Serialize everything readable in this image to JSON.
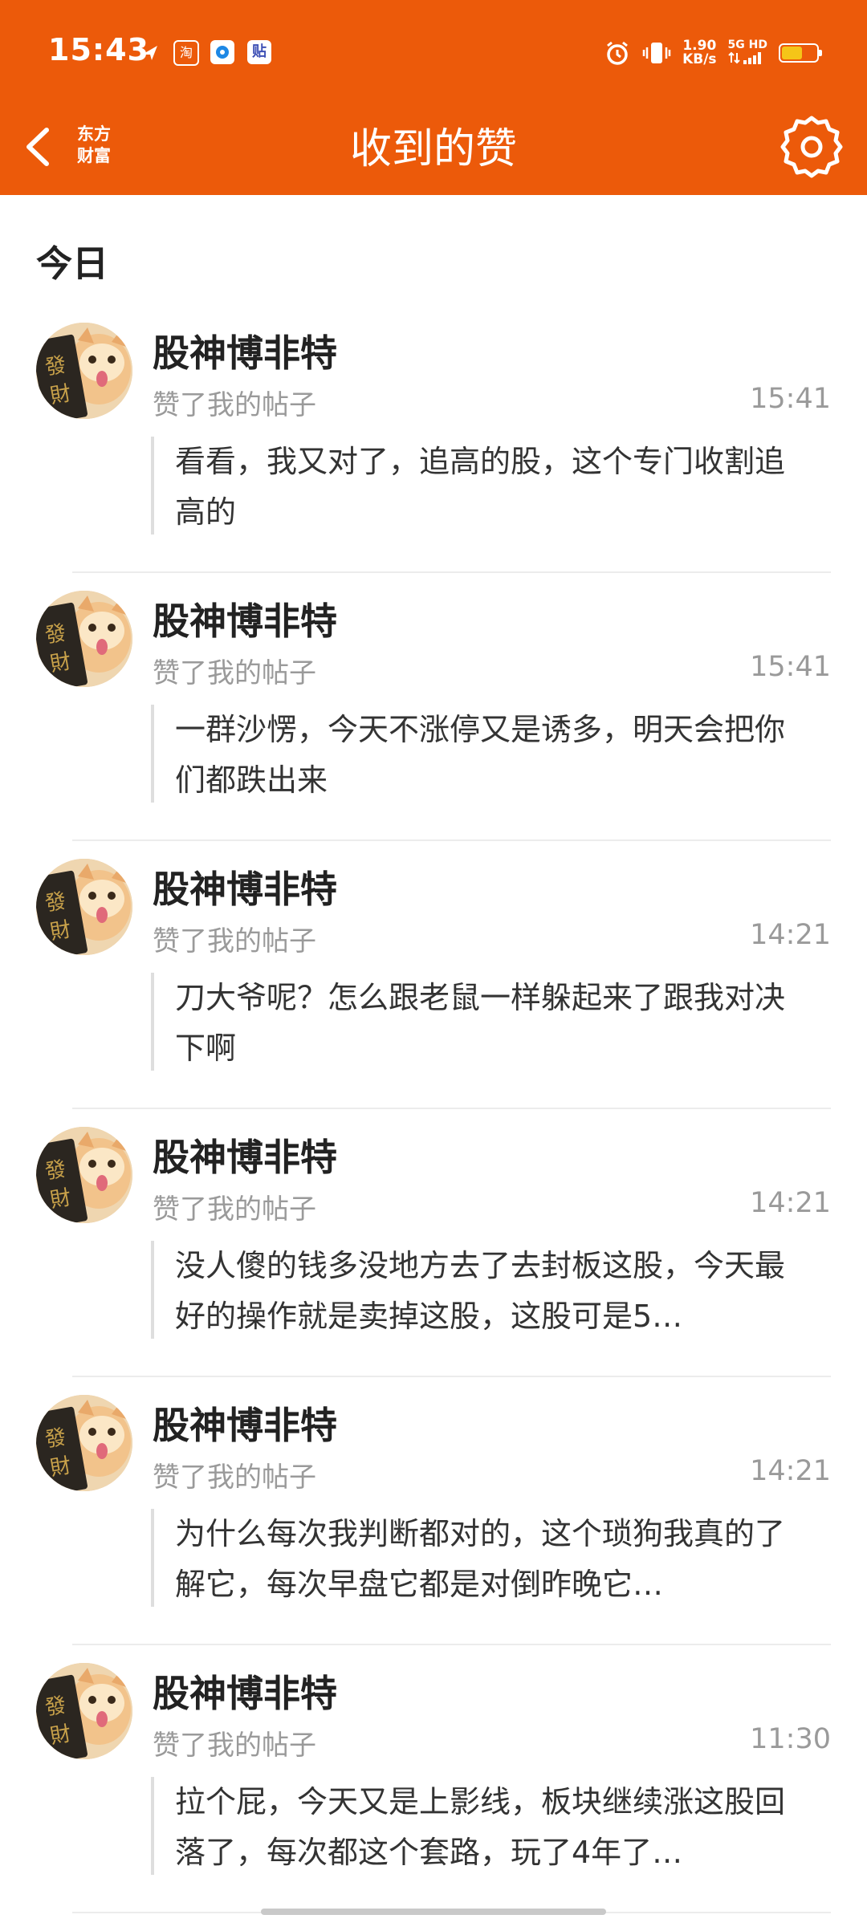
{
  "status_bar": {
    "time": "15:43",
    "app_icons": [
      "navigation-icon",
      "taobao-icon",
      "app-icon",
      "tieba-icon"
    ],
    "speed_top": "1.90",
    "speed_bottom": "KB/s",
    "network_top": "5G HD",
    "network_bottom": "",
    "battery_level": 0.6
  },
  "header": {
    "logo_line1": "东方",
    "logo_line2": "财富",
    "title": "收到的赞"
  },
  "colors": {
    "header_bg": "#EC5A0A",
    "battery": "#F5C518"
  },
  "section_title": "今日",
  "likes": [
    {
      "username": "股神博非特",
      "action": "赞了我的帖子",
      "time": "15:41",
      "post": "看看，我又对了，追高的股，这个专门收割追高的"
    },
    {
      "username": "股神博非特",
      "action": "赞了我的帖子",
      "time": "15:41",
      "post": "一群沙愣，今天不涨停又是诱多，明天会把你们都跌出来"
    },
    {
      "username": "股神博非特",
      "action": "赞了我的帖子",
      "time": "14:21",
      "post": "刀大爷呢？怎么跟老鼠一样躲起来了跟我对决下啊"
    },
    {
      "username": "股神博非特",
      "action": "赞了我的帖子",
      "time": "14:21",
      "post": "没人傻的钱多没地方去了去封板这股，今天最好的操作就是卖掉这股，这股可是5…"
    },
    {
      "username": "股神博非特",
      "action": "赞了我的帖子",
      "time": "14:21",
      "post": "为什么每次我判断都对的，这个琐狗我真的了解它，每次早盘它都是对倒昨晚它…"
    },
    {
      "username": "股神博非特",
      "action": "赞了我的帖子",
      "time": "11:30",
      "post": "拉个屁，今天又是上影线，板块继续涨这股回落了，每次都这个套路，玩了4年了…"
    }
  ]
}
